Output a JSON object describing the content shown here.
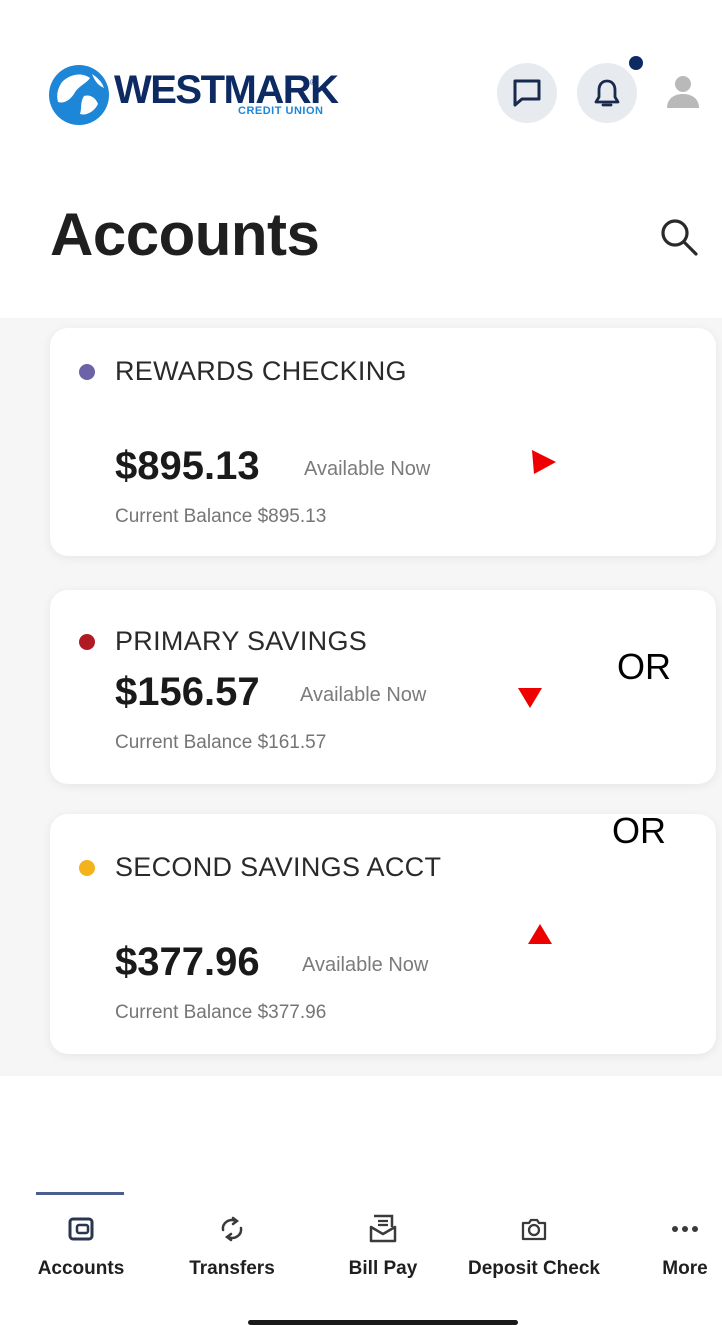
{
  "brand": {
    "name": "WESTMARK",
    "tagline": "CREDIT UNION",
    "trademark": "®",
    "navy": "#0d2a63",
    "blue": "#1e86d6"
  },
  "header": {
    "title": "Accounts",
    "icons": [
      "chat-icon",
      "bell-icon",
      "profile-icon",
      "search-icon"
    ],
    "notification_dot": true
  },
  "accounts": [
    {
      "name": "REWARDS CHECKING",
      "color": "#6c63a6",
      "amount": "$895.13",
      "available_label": "Available Now",
      "current_balance": "Current Balance $895.13",
      "trend": "triangle-right"
    },
    {
      "name": "PRIMARY SAVINGS",
      "color": "#b01a25",
      "amount": "$156.57",
      "available_label": "Available Now",
      "current_balance": "Current Balance $161.57",
      "trend": "triangle-down"
    },
    {
      "name": "SECOND SAVINGS ACCT",
      "color": "#f4b31c",
      "amount": "$377.96",
      "available_label": "Available Now",
      "current_balance": "Current Balance $377.96",
      "trend": "triangle-up"
    }
  ],
  "annotations": {
    "or_1": "OR",
    "or_2": "OR",
    "marker_color": "#ee0000"
  },
  "nav": {
    "active": "Accounts",
    "items": [
      {
        "label": "Accounts",
        "icon": "wallet-icon"
      },
      {
        "label": "Transfers",
        "icon": "transfer-icon"
      },
      {
        "label": "Bill Pay",
        "icon": "bill-icon"
      },
      {
        "label": "Deposit Check",
        "icon": "camera-icon"
      },
      {
        "label": "More",
        "icon": "more-icon"
      }
    ]
  }
}
